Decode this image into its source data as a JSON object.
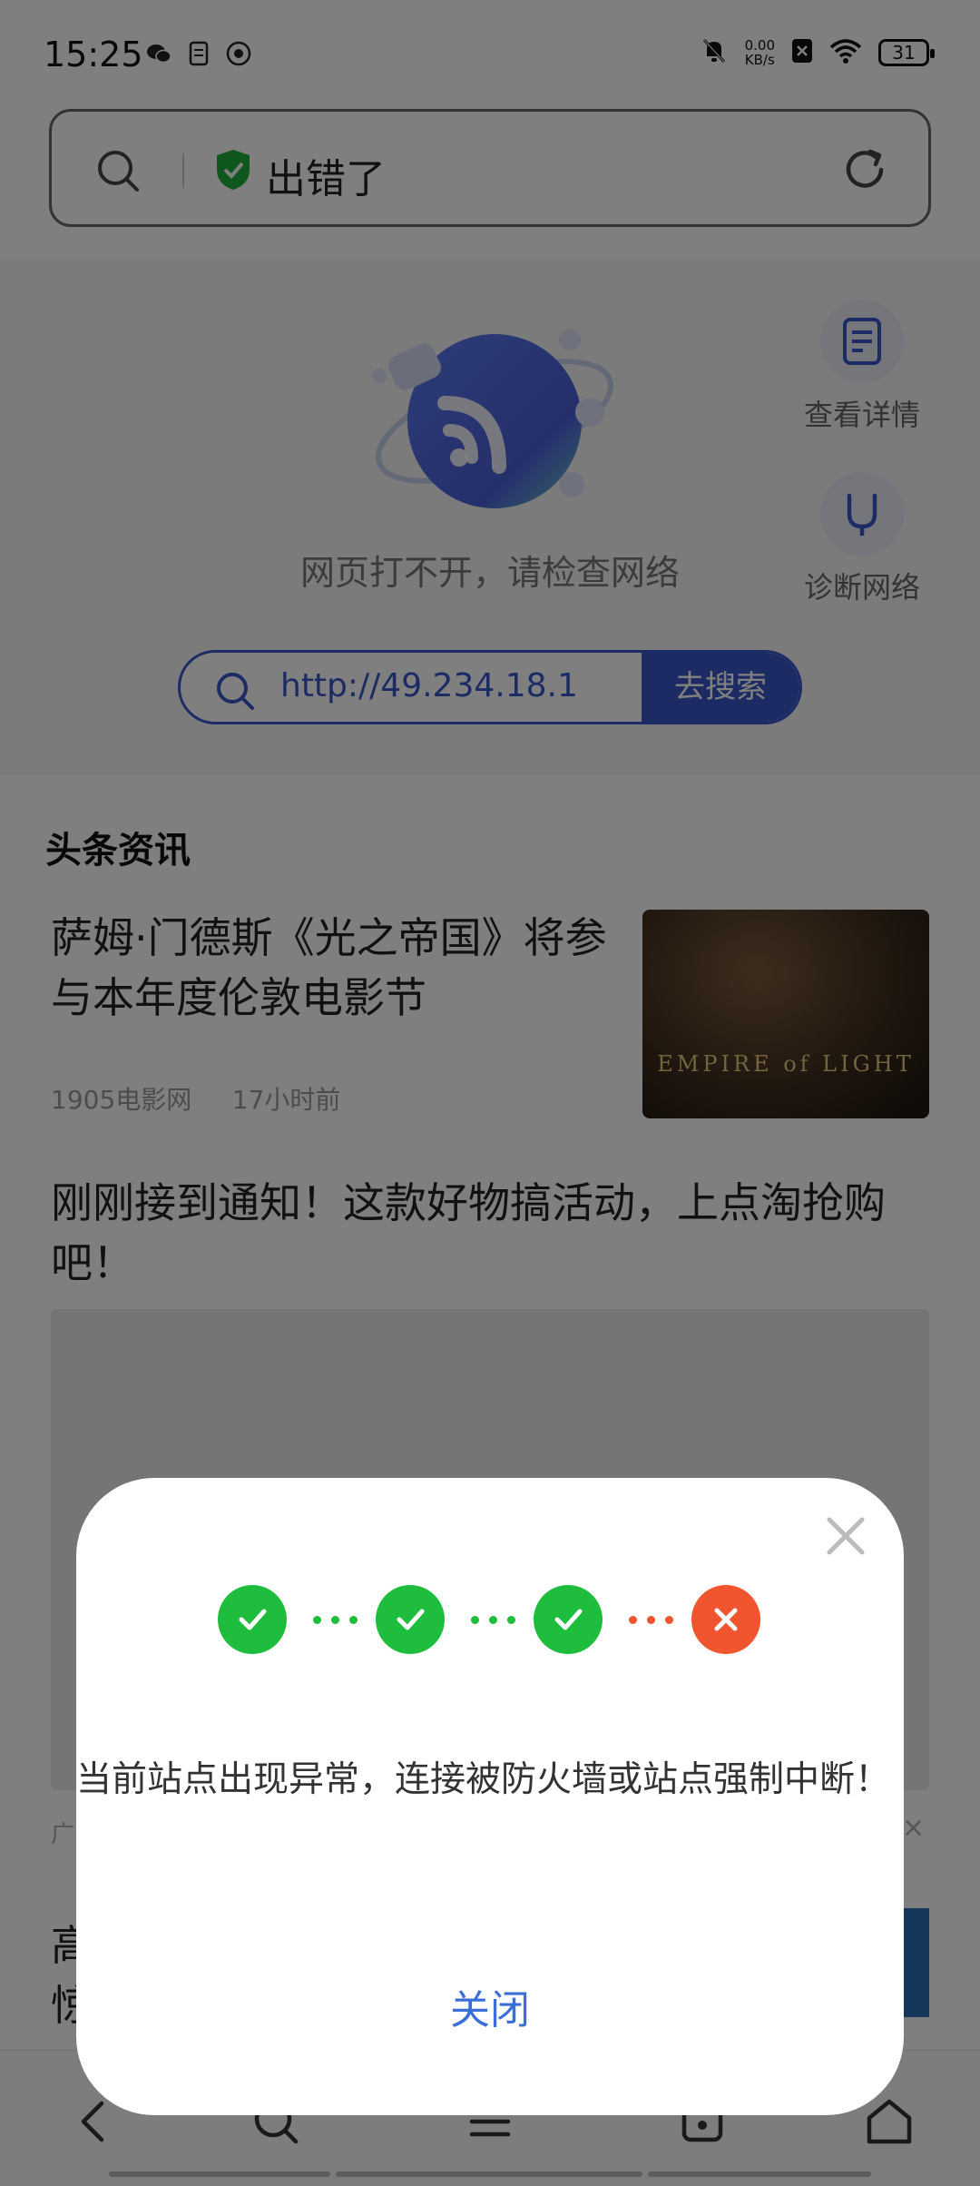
{
  "status_bar": {
    "time": "15:25",
    "net_speed_value": "0.00",
    "net_speed_unit": "KB/s",
    "battery": "31",
    "left_icons": [
      "wechat-icon",
      "document-icon",
      "browser-icon"
    ],
    "right_icons": [
      "mute-bell-icon",
      "no-sim-icon",
      "wifi-icon",
      "battery-icon"
    ]
  },
  "address_bar": {
    "title": "出错了"
  },
  "error_page": {
    "message": "网页打不开，请检查网络",
    "view_details_label": "查看详情",
    "diagnose_label": "诊断网络",
    "search_url": "http://49.234.18.1···",
    "search_button_label": "去搜索"
  },
  "news": {
    "section_title": "头条资讯",
    "items": [
      {
        "title": "萨姆·门德斯《光之帝国》将参与本年度伦敦电影节",
        "source": "1905电影网",
        "time": "17小时前",
        "thumb_text": "EMPIRE of LIGHT"
      },
      {
        "title": "刚刚接到通知！这款好物搞活动，上点淘抢购吧！"
      }
    ],
    "ad_label": "广",
    "ad_close": "×",
    "partial_item_text": "高\n惊"
  },
  "dialog": {
    "steps": [
      "ok",
      "ok",
      "ok",
      "fail"
    ],
    "message": "当前站点出现异常，连接被防火墙或站点强制中断！",
    "close_label": "关闭"
  },
  "bottom_nav": {
    "icons": [
      "back-icon",
      "search-icon",
      "menu-icon",
      "tabs-icon",
      "home-icon"
    ]
  },
  "colors": {
    "accent_blue": "#3a57c9",
    "success_green": "#1fbd3d",
    "error_red": "#f05530",
    "link_blue": "#3a6fd8"
  }
}
